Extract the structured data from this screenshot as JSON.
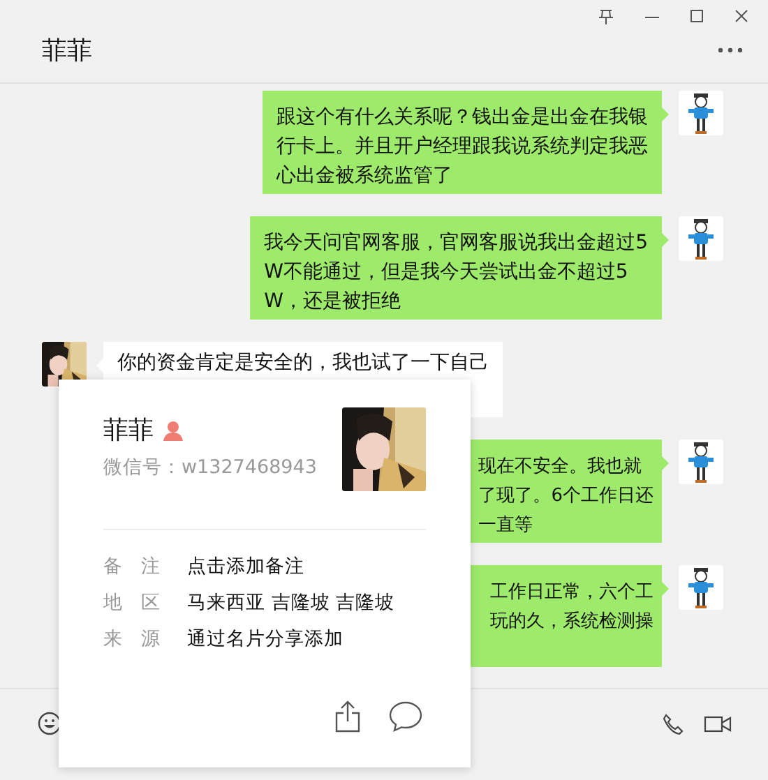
{
  "chat": {
    "title": "菲菲"
  },
  "messages": [
    {
      "kind": "outgoing",
      "lines": [
        "跟这个有什么关系呢？钱出金是出金在我银",
        "行卡上。并且开户经理跟我说系统判定我恶",
        "心出金被系统监管了"
      ]
    },
    {
      "kind": "outgoing",
      "lines": [
        "我今天问官网客服，官网客服说我出金超过5",
        "W不能通过，但是我今天尝试出金不超过5",
        "W，还是被拒绝"
      ]
    },
    {
      "kind": "incoming",
      "lines": [
        "你的资金肯定是安全的，我也试了一下自己"
      ]
    },
    {
      "kind": "outgoing_covered",
      "lines": [
        "现在不安全。我也就",
        "了现了。6个工作日还",
        "一直等"
      ]
    },
    {
      "kind": "outgoing_covered",
      "lines": [
        "工作日正常，六个工",
        "玩的久，系统检测操"
      ]
    }
  ],
  "profile": {
    "name": "菲菲",
    "wechat_id": "微信号：w1327468943",
    "fields": [
      {
        "label": "备注",
        "value": "点击添加备注"
      },
      {
        "label": "地区",
        "value": "马来西亚 吉隆坡 吉隆坡"
      },
      {
        "label": "来源",
        "value": "通过名片分享添加"
      }
    ]
  }
}
